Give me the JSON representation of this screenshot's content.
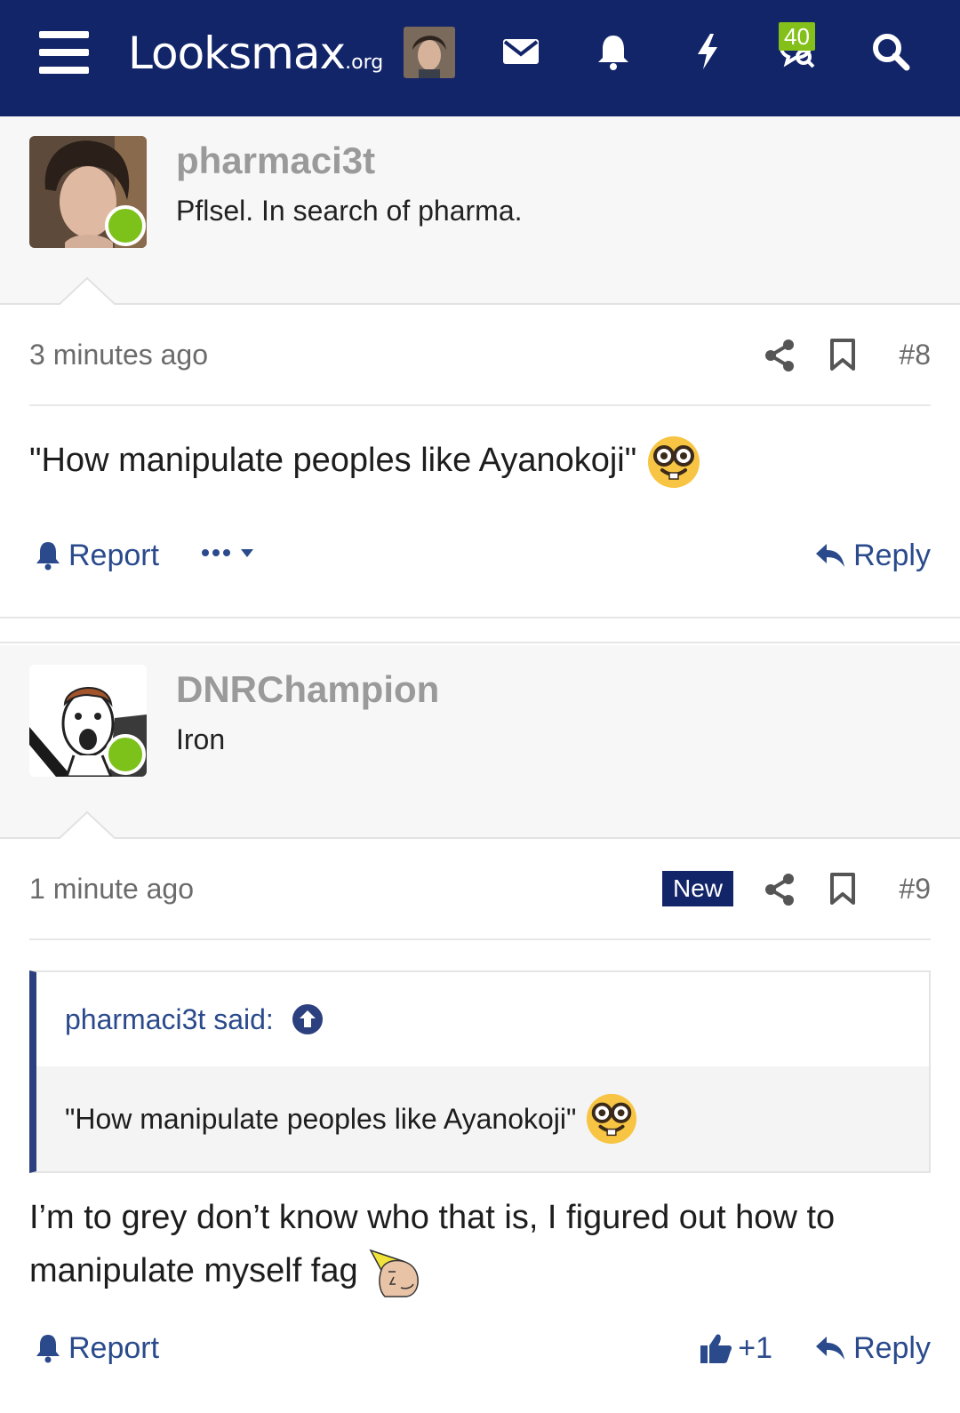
{
  "header": {
    "logo_main": "Looksmax",
    "logo_tld": ".org",
    "notification_count": "40"
  },
  "posts": [
    {
      "username": "pharmaci3t",
      "user_title": "Pflsel. In search of pharma.",
      "time": "3 minutes ago",
      "number": "#8",
      "text": "\"How manipulate peoples like Ayanokoji\"",
      "emoji": "nerd-face-emoji",
      "report_label": "Report",
      "reply_label": "Reply"
    },
    {
      "username": "DNRChampion",
      "user_title": "Iron",
      "time": "1 minute ago",
      "new_label": "New",
      "number": "#9",
      "quote": {
        "author_label": "pharmaci3t said:",
        "text": "\"How manipulate peoples like Ayanokoji\"",
        "emoji": "nerd-face-emoji"
      },
      "text": "I’m to grey don’t know who that is, I figured out how to manipulate myself fag",
      "emoji": "chad-icon",
      "report_label": "Report",
      "like_label": "+1",
      "reply_label": "Reply"
    }
  ],
  "colors": {
    "header_bg": "#132569",
    "link": "#2a4a8c",
    "online": "#7dc11b",
    "badge": "#83c01a"
  }
}
